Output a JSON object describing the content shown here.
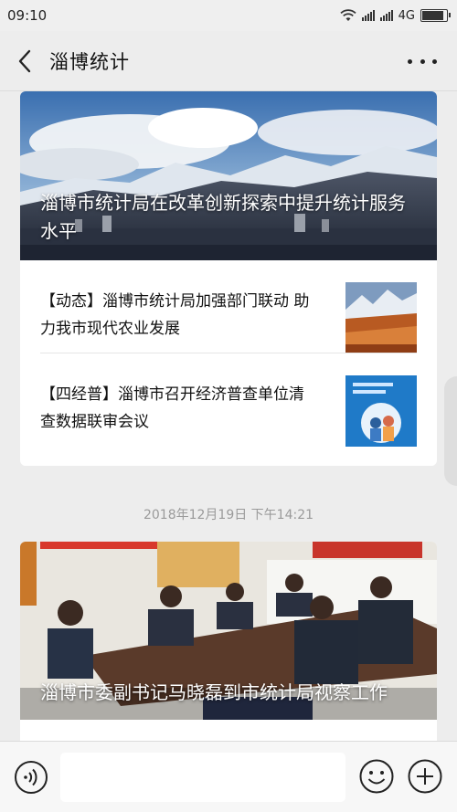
{
  "status_bar": {
    "time": "09:10",
    "network": "4G",
    "battery_level": 0.9
  },
  "nav": {
    "title": "淄博统计"
  },
  "articles": {
    "group1": {
      "headline": "淄博市统计局在改革创新探索中提升统计服务水平",
      "items": [
        {
          "title": "【动态】淄博市统计局加强部门联动 助力我市现代农业发展"
        },
        {
          "title": "【四经普】淄博市召开经济普查单位清查数据联审会议"
        }
      ]
    },
    "timestamp": "2018年12月19日 下午14:21",
    "group2": {
      "headline": "淄博市委副书记马晓磊到市统计局视察工作"
    }
  },
  "icons": {
    "back": "chevron-left-icon",
    "more": "more-dots-icon",
    "voice": "voice-icon",
    "emoji": "emoji-icon",
    "plus": "plus-icon"
  }
}
